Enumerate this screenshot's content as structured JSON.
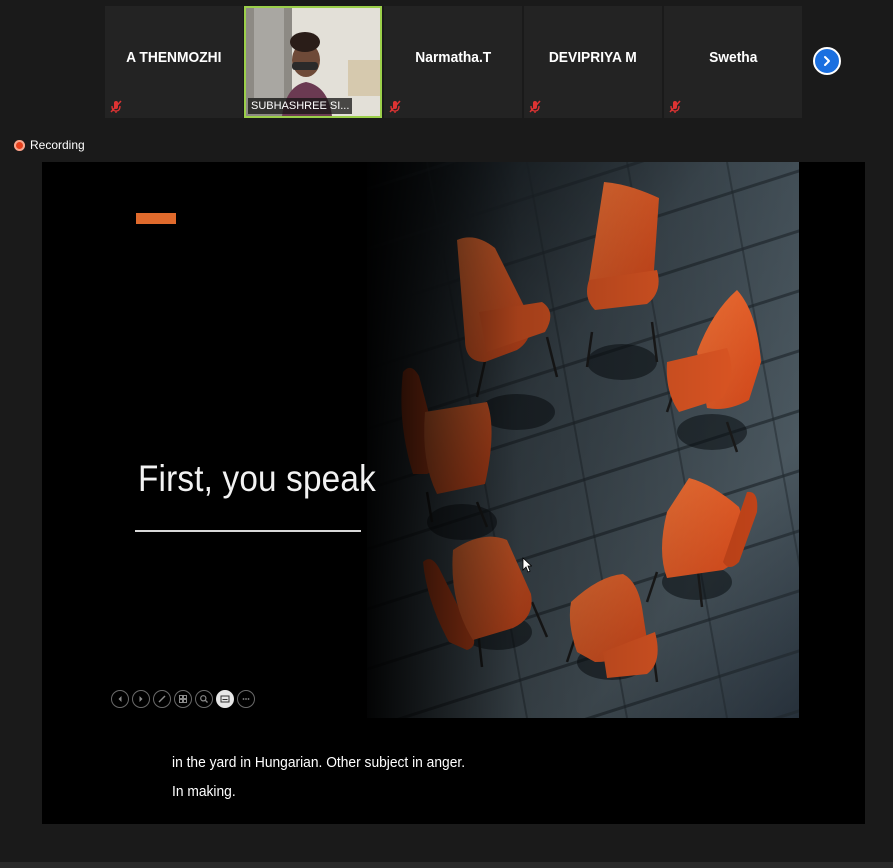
{
  "participants": [
    {
      "name": "A THENMOZHI",
      "muted": true
    },
    {
      "name": "SUBHASHREE SI...",
      "video": true
    },
    {
      "name": "Narmatha.T",
      "muted": true
    },
    {
      "name": "DEVIPRIYA M",
      "muted": true
    },
    {
      "name": "Swetha",
      "muted": true
    }
  ],
  "recording": {
    "label": "Recording"
  },
  "slide": {
    "title": "First, you speak",
    "accent_color": "#e06a2c",
    "image": "orange-chairs-in-circle"
  },
  "slideshow_controls": [
    "previous-icon",
    "next-icon",
    "pen-icon",
    "slides-grid-icon",
    "zoom-icon",
    "subtitles-icon",
    "more-icon"
  ],
  "captions": {
    "line1": "in the yard in Hungarian. Other subject in anger.",
    "line2": "In making."
  },
  "colors": {
    "accent_blue": "#1a6fe0",
    "speaker_border": "#9bcf4a",
    "recording_red": "#e8401c"
  }
}
